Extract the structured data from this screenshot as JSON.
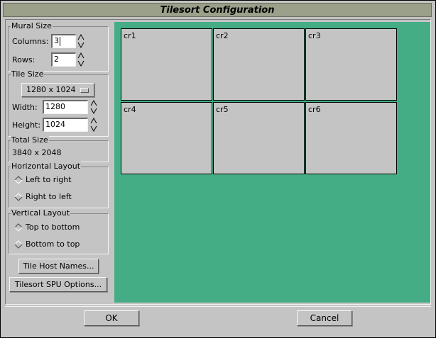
{
  "window": {
    "title": "Tilesort Configuration"
  },
  "mural_size": {
    "label": "Mural Size",
    "columns_label": "Columns:",
    "columns_value": "3",
    "rows_label": "Rows:",
    "rows_value": "2"
  },
  "tile_size": {
    "label": "Tile Size",
    "preset": "1280 x 1024",
    "width_label": "Width:",
    "width_value": "1280",
    "height_label": "Height:",
    "height_value": "1024"
  },
  "total_size": {
    "label": "Total Size",
    "value": "3840 x 2048"
  },
  "horizontal_layout": {
    "label": "Horizontal Layout",
    "options": [
      "Left to right",
      "Right to left"
    ],
    "selected": 0
  },
  "vertical_layout": {
    "label": "Vertical Layout",
    "options": [
      "Top to bottom",
      "Bottom to top"
    ],
    "selected": 0
  },
  "buttons": {
    "host_names": "Tile Host Names...",
    "spu_options": "Tilesort SPU Options...",
    "ok": "OK",
    "cancel": "Cancel"
  },
  "tiles": [
    "cr1",
    "cr2",
    "cr3",
    "cr4",
    "cr5",
    "cr6"
  ],
  "colors": {
    "canvas": "#45ad85",
    "tile": "#c4c4c4",
    "titlebar": "#9aa089"
  }
}
